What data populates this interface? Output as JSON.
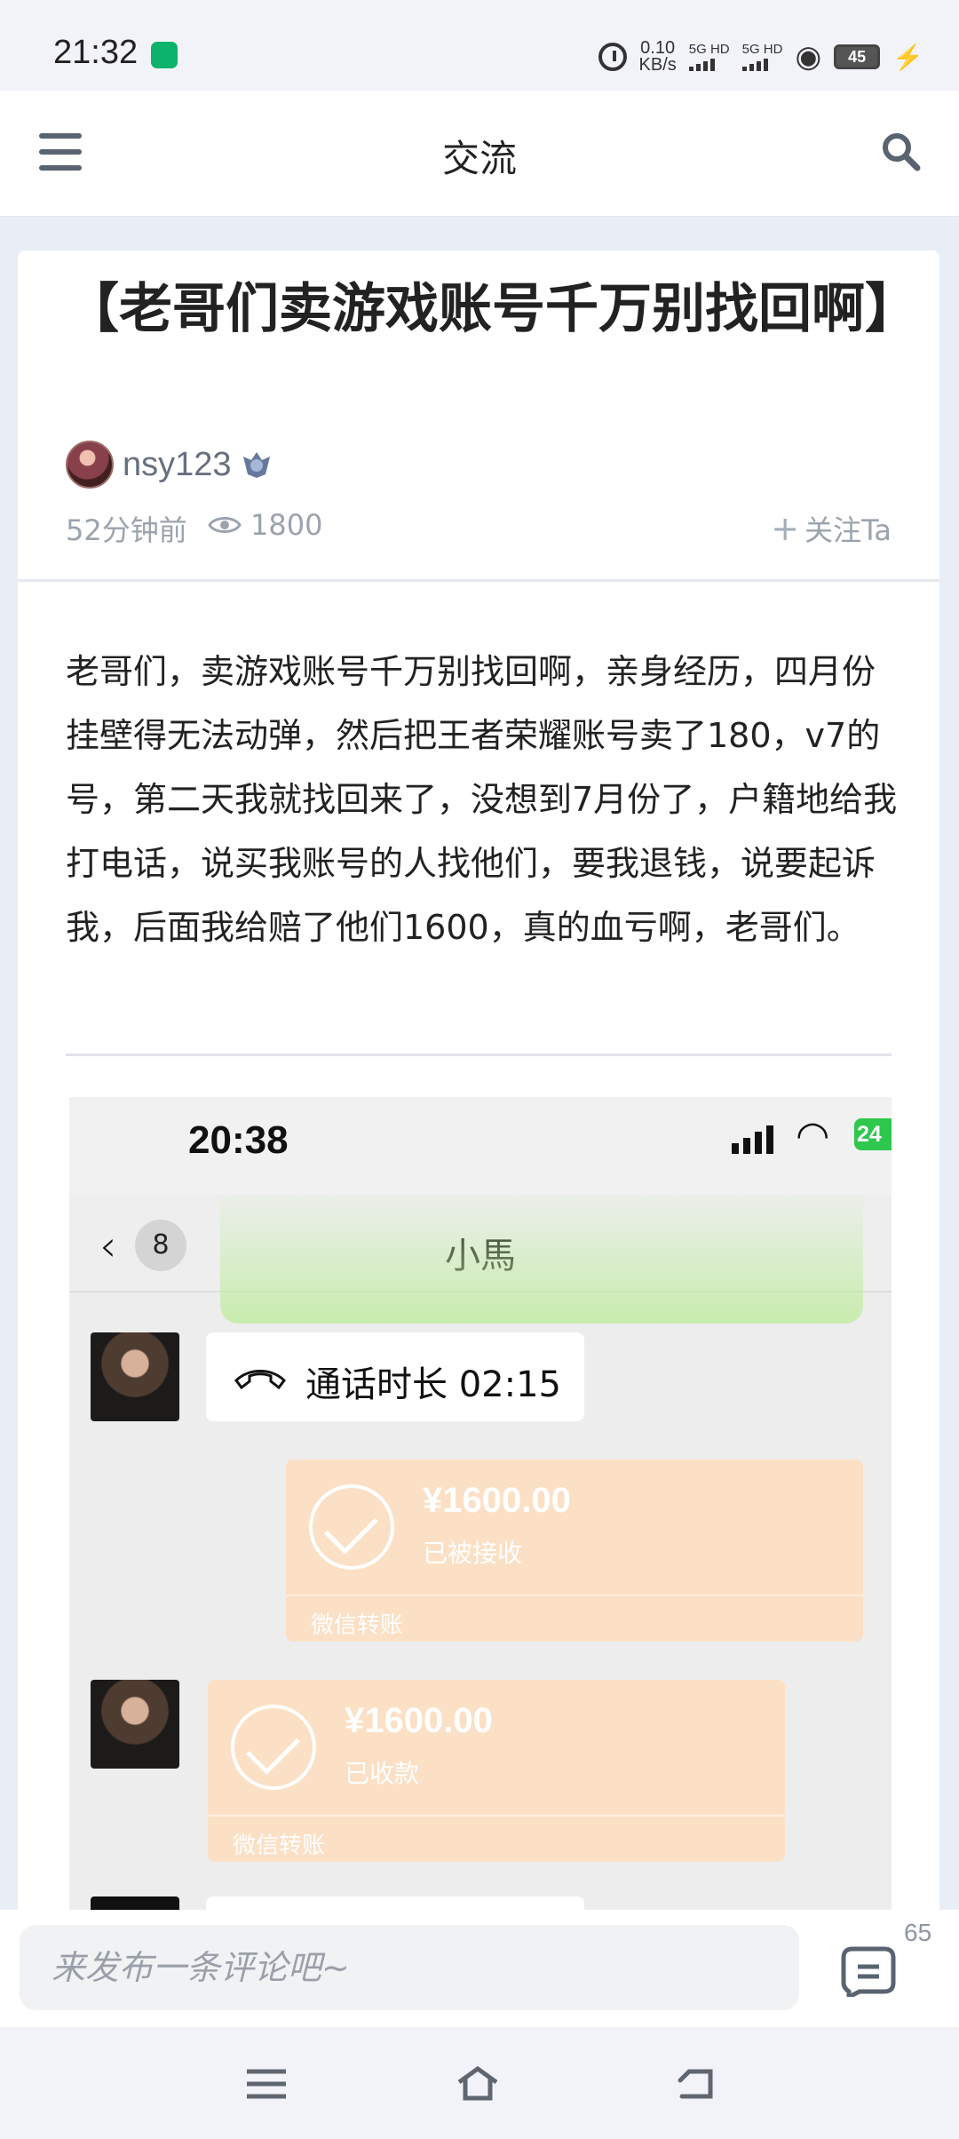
{
  "status_bar": {
    "time": "21:32",
    "network_speed": "0.10",
    "network_unit": "KB/s",
    "signal_1": "5G HD",
    "signal_2": "5G HD",
    "battery": "45"
  },
  "header": {
    "title": "交流",
    "menu_icon": "menu-icon",
    "search_icon": "search-icon"
  },
  "post": {
    "title": "【老哥们卖游戏账号千万别找回啊】",
    "author": "nsy123",
    "time": "52分钟前",
    "views": "1800",
    "follow_label": "关注Ta",
    "body": "老哥们，卖游戏账号千万别找回啊，亲身经历，四月份挂壁得无法动弹，然后把王者荣耀账号卖了180，v7的号，第二天我就找回来了，没想到7月份了，户籍地给我打电话，说买我账号的人找他们，要我退钱，说要起诉我，后面我给赔了他们1600，真的血亏啊，老哥们。"
  },
  "embedded_screenshot": {
    "time": "20:38",
    "battery": "24",
    "unread_count": "8",
    "contact_name": "小馬",
    "call_text": "通话时长 02:15",
    "transfer_1": {
      "amount": "¥1600.00",
      "status": "已被接收",
      "label": "微信转账"
    },
    "transfer_2": {
      "amount": "¥1600.00",
      "status": "已收款",
      "label": "微信转账"
    }
  },
  "comment_bar": {
    "placeholder": "来发布一条评论吧~",
    "comment_count": "65"
  },
  "colors": {
    "accent": "#5a6370",
    "transfer": "#fbe0c5",
    "background": "#e9edf5"
  }
}
